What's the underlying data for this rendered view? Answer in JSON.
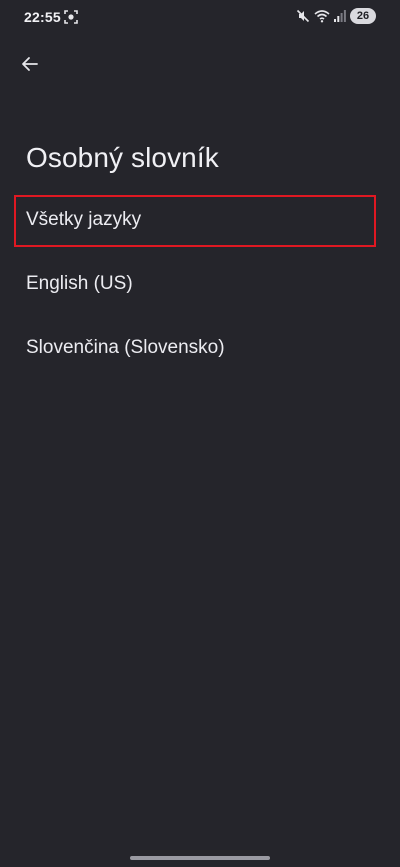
{
  "status_bar": {
    "time": "22:55",
    "battery_level": "26",
    "icons": [
      "screen-record-icon",
      "mute-icon",
      "wifi-icon",
      "signal-icon",
      "battery-icon"
    ]
  },
  "header": {
    "back_icon": "arrow-left-icon",
    "title": "Osobný slovník"
  },
  "languages": [
    {
      "label": "Všetky jazyky",
      "highlighted": true
    },
    {
      "label": "English (US)",
      "highlighted": false
    },
    {
      "label": "Slovenčina (Slovensko)",
      "highlighted": false
    }
  ],
  "colors": {
    "background": "#25252b",
    "text": "#ececf1",
    "highlight_border": "#e01822"
  }
}
